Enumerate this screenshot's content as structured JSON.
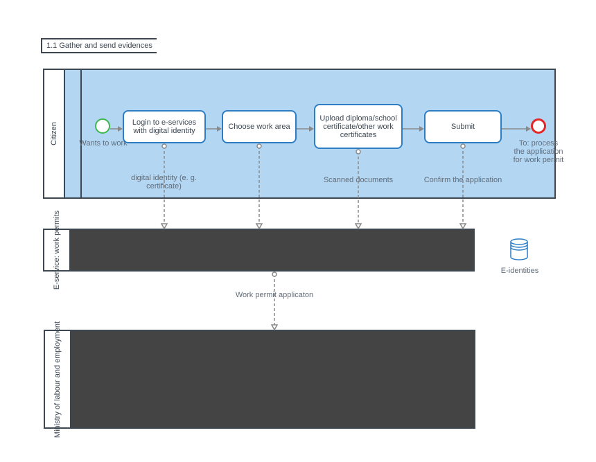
{
  "title": "1.1 Gather and send evidences",
  "pools": {
    "citizen": {
      "label": "Citizen"
    },
    "eservice": {
      "label": "E-service: work permits"
    },
    "ministry": {
      "label": "Ministry of labour and employment"
    }
  },
  "events": {
    "start": {
      "label": "Wants to work"
    },
    "end": {
      "label": "To: process the application for work permit"
    }
  },
  "tasks": {
    "login": {
      "label": "Login to e-services with digital identity",
      "assoc": "digital identity (e. g. certificate)"
    },
    "choose": {
      "label": "Choose work area",
      "assoc": ""
    },
    "upload": {
      "label": "Upload diploma/school certificate/other work certificates",
      "assoc": "Scanned documents"
    },
    "submit": {
      "label": "Submit",
      "assoc": "Confirm the application"
    }
  },
  "messages": {
    "workpermit": "Work permit applicaton"
  },
  "datastore": {
    "eidentities": "E-identities"
  }
}
